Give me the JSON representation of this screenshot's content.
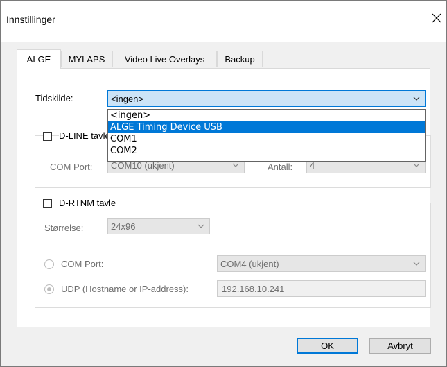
{
  "window": {
    "title": "Innstillinger"
  },
  "tabs": [
    {
      "label": "ALGE",
      "active": true
    },
    {
      "label": "MYLAPS",
      "active": false
    },
    {
      "label": "Video Live Overlays",
      "active": false
    },
    {
      "label": "Backup",
      "active": false
    }
  ],
  "tidskilde": {
    "label": "Tidskilde:",
    "value": "<ingen>",
    "options": [
      "<ingen>",
      "ALGE Timing Device USB",
      "COM1",
      "COM2"
    ],
    "highlighted": "ALGE Timing Device USB"
  },
  "dline": {
    "label": "D-LINE tavle",
    "com_port_label": "COM Port:",
    "com_port_value": "COM10 (ukjent)",
    "antall_label": "Antall:",
    "antall_value": "4"
  },
  "drtnm": {
    "label": "D-RTNM tavle",
    "size_label": "Størrelse:",
    "size_value": "24x96",
    "com_port_label": "COM Port:",
    "com_port_value": "COM4 (ukjent)",
    "udp_label": "UDP (Hostname or IP-address):",
    "udp_value": "192.168.10.241"
  },
  "buttons": {
    "ok": "OK",
    "cancel": "Avbryt"
  },
  "icons": {
    "close": "close-icon",
    "chevron": "chevron-down-icon"
  },
  "colors": {
    "accent": "#0078d7",
    "highlight": "#cce4f7"
  }
}
